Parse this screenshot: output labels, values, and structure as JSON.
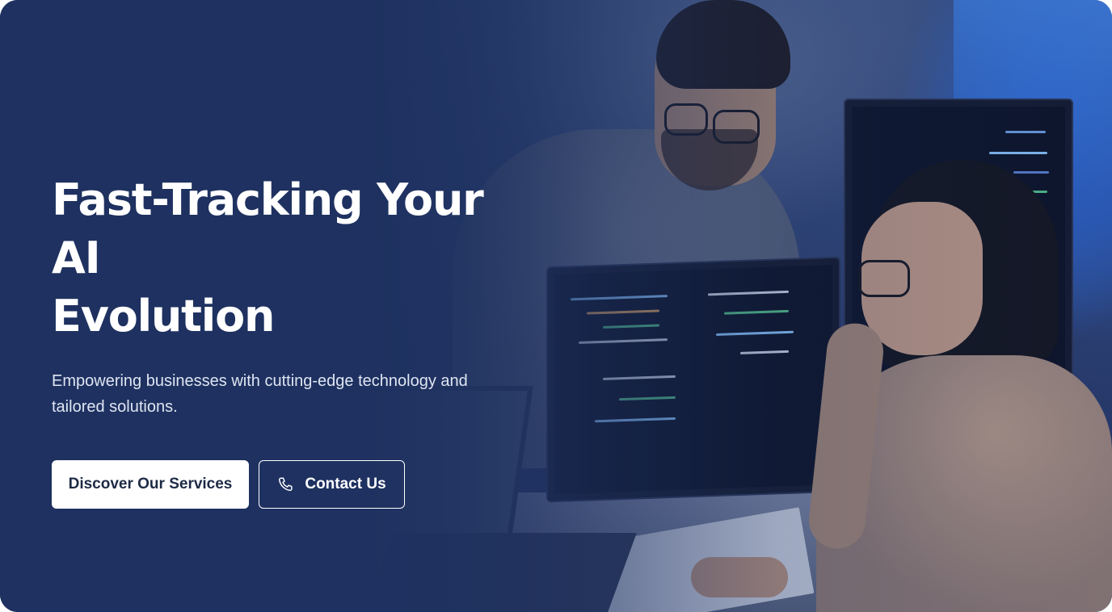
{
  "hero": {
    "title_line1": "Fast-Tracking Your AI",
    "title_line2": "Evolution",
    "subtitle": "Empowering businesses with cutting-edge technology and tailored solutions.",
    "primary_button": "Discover Our Services",
    "secondary_button": "Contact Us",
    "secondary_button_icon": "phone-icon"
  },
  "colors": {
    "background": "#1e3160",
    "primary_button_bg": "#ffffff",
    "primary_button_text": "#1e2a45",
    "text": "#ffffff"
  }
}
